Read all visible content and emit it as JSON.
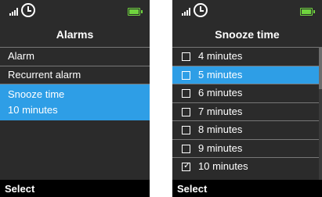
{
  "colors": {
    "screen_bg": "#2b2b2b",
    "highlight": "#2e9ee6",
    "battery": "#6fd43e",
    "softkey_bg": "#000000"
  },
  "left_screen": {
    "status_icons": [
      "signal-icon",
      "clock-icon",
      "battery-icon"
    ],
    "title": "Alarms",
    "menu_items": [
      {
        "label": "Alarm"
      },
      {
        "label": "Recurrent alarm"
      },
      {
        "label": "Snooze time",
        "value": "10 minutes",
        "selected": true
      }
    ],
    "softkey": "Select"
  },
  "right_screen": {
    "status_icons": [
      "signal-icon",
      "clock-icon",
      "battery-icon"
    ],
    "title": "Snooze time",
    "options": [
      {
        "label": "4 minutes",
        "checked": false,
        "highlighted": false
      },
      {
        "label": "5 minutes",
        "checked": false,
        "highlighted": true
      },
      {
        "label": "6 minutes",
        "checked": false,
        "highlighted": false
      },
      {
        "label": "7 minutes",
        "checked": false,
        "highlighted": false
      },
      {
        "label": "8 minutes",
        "checked": false,
        "highlighted": false
      },
      {
        "label": "9 minutes",
        "checked": false,
        "highlighted": false
      },
      {
        "label": "10 minutes",
        "checked": true,
        "highlighted": false
      }
    ],
    "softkey": "Select"
  }
}
